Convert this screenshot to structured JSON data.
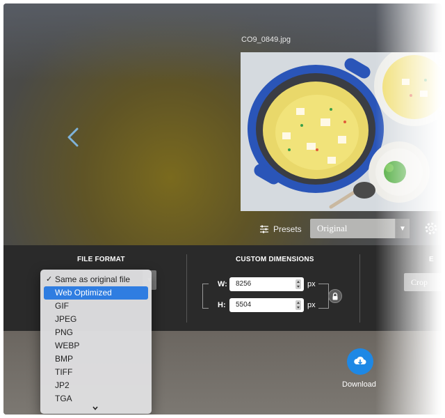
{
  "preview": {
    "filename": "CO9_0849.jpg"
  },
  "controls": {
    "presets_label": "Presets",
    "size_select_value": "Original"
  },
  "sections": {
    "file_format_title": "FILE FORMAT",
    "custom_dimensions_title": "CUSTOM DIMENSIONS",
    "third_title": "E"
  },
  "dimensions": {
    "width_label": "W:",
    "width_value": "8256",
    "height_label": "H:",
    "height_value": "5504",
    "unit": "px"
  },
  "crop": {
    "label": "Crop"
  },
  "download": {
    "label": "Download"
  },
  "format_dropdown": {
    "checked_option": "Same as original file",
    "highlighted_option": "Web Optimized",
    "options": [
      "Same as original file",
      "Web Optimized",
      "GIF",
      "JPEG",
      "PNG",
      "WEBP",
      "BMP",
      "TIFF",
      "JP2",
      "TGA"
    ]
  },
  "colors": {
    "accent_blue": "#1e88e5",
    "highlight_blue": "#2f7de1",
    "panel_dark": "#2a2a2a"
  },
  "icons": [
    "back-arrow-icon",
    "sliders-icon",
    "dropdown-arrow-icon",
    "gear-icon",
    "lock-icon",
    "cloud-download-icon",
    "checkmark-icon",
    "chevron-down-icon"
  ]
}
